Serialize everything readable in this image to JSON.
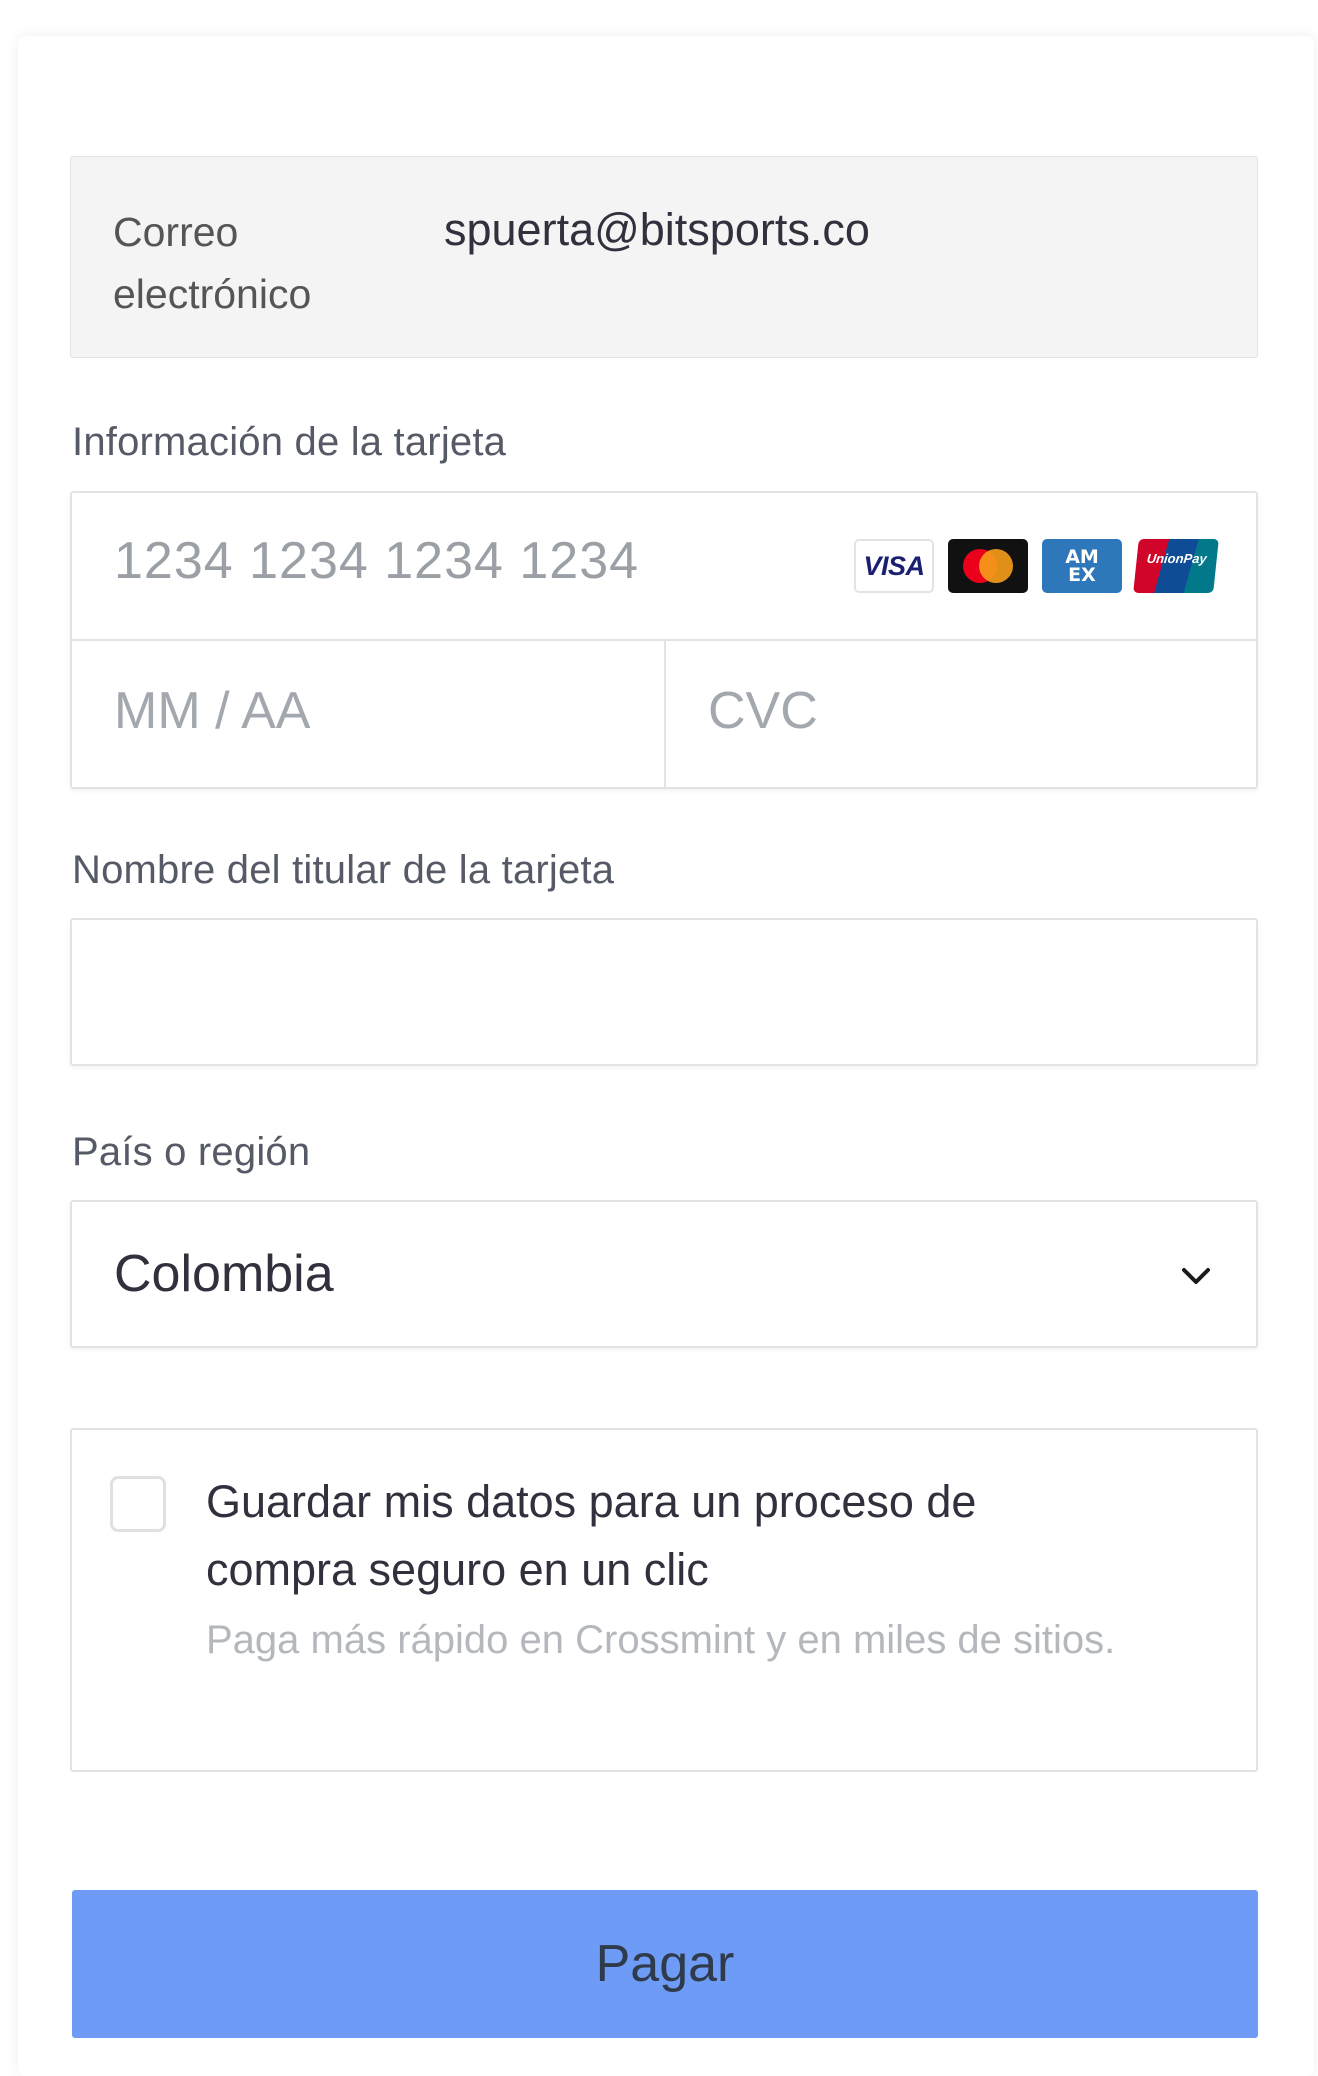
{
  "email": {
    "label": "Correo electrónico",
    "value": "spuerta@bitsports.co"
  },
  "card_info": {
    "label": "Información de la tarjeta",
    "number_placeholder": "1234 1234 1234 1234",
    "expiry_placeholder": "MM / AA",
    "cvc_placeholder": "CVC",
    "brands": {
      "visa": "VISA",
      "amex_line1": "AM",
      "amex_line2": "EX",
      "unionpay": "UnionPay"
    }
  },
  "cardholder": {
    "label": "Nombre del titular de la tarjeta",
    "value": ""
  },
  "country": {
    "label": "País o región",
    "selected": "Colombia",
    "icon": "chevron-down-icon"
  },
  "save_info": {
    "checked": false,
    "title": "Guardar mis datos para un proceso de compra seguro en un clic",
    "subtitle": "Paga más rápido en Crossmint y en miles de sitios."
  },
  "pay_button": {
    "label": "Pagar",
    "color": "#6d9bf5"
  }
}
